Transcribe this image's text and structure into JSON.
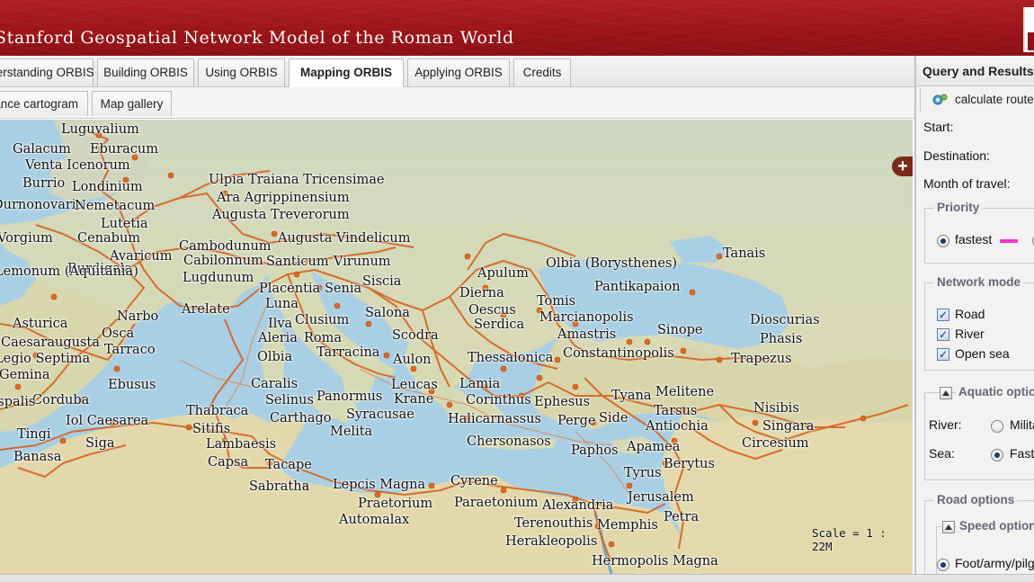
{
  "header": {
    "title": "Stanford Geospatial Network Model of the Roman World",
    "brand_color": "#9c1519"
  },
  "tabs": [
    {
      "label": "Understanding ORBIS"
    },
    {
      "label": "Building ORBIS"
    },
    {
      "label": "Using ORBIS"
    },
    {
      "label": "Mapping ORBIS",
      "active": true
    },
    {
      "label": "Applying ORBIS"
    },
    {
      "label": "Credits"
    }
  ],
  "subtabs": [
    {
      "label": "Distance cartogram"
    },
    {
      "label": "Map gallery"
    }
  ],
  "map": {
    "scale_text": "Scale = 1 : 22M",
    "zoom_in_label": "+",
    "road_color": "#d4621f",
    "sea_color": "#a9cfe4",
    "land_color": "#d8dcb7",
    "cities": [
      "Luguvalium",
      "Galacum",
      "Eburacum",
      "Venta Icenorum",
      "Burrio",
      "Londinium",
      "Durnonovaria",
      "Nemetacum",
      "Lutetia",
      "Vorgium",
      "Cenabum",
      "Avaricum",
      "Burdigala",
      "Lemonum (Aquitania)",
      "Narbo",
      "Lugdunum",
      "Arelate",
      "Cambodunum",
      "Cabilonnum",
      "Santicum",
      "Virunum",
      "Augusta Vindelicum",
      "Augusta Treverorum",
      "Ara Agrippinensium",
      "Ulpia Traiana Tricensimae",
      "Placentia",
      "Senia",
      "Siscia",
      "Luna",
      "Ilva",
      "Clusium",
      "Aleria",
      "Roma",
      "Olbia",
      "Tarracina",
      "Salona",
      "Scodra",
      "Aulon",
      "Caralis",
      "Selinus",
      "Panormus",
      "Carthago",
      "Syracusae",
      "Melita",
      "Leucas",
      "Krane",
      "Lamia",
      "Corinthus",
      "Ephesus",
      "Thessalonica",
      "Apulum",
      "Dierna",
      "Oescus",
      "Serdica",
      "Tomis",
      "Marcianopolis",
      "Olbia (Borysthenes)",
      "Pantikapaion",
      "Tanais",
      "Amastris",
      "Sinope",
      "Constantinopolis",
      "Dioscurias",
      "Phasis",
      "Trapezus",
      "Tyana",
      "Melitene",
      "Tarsus",
      "Antiochia",
      "Nisibis",
      "Singara",
      "Circesium",
      "Perge",
      "Side",
      "Halicarnassus",
      "Chersonasos",
      "Paphos",
      "Apamea",
      "Tyrus",
      "Berytus",
      "Jerusalem",
      "Petra",
      "Cyrene",
      "Paraetonium",
      "Alexandria",
      "Memphis",
      "Terenouthis",
      "Herakleopolis",
      "Hermopolis Magna",
      "Lepcis Magna",
      "Praetorium",
      "Automalax",
      "Sabratha",
      "Tacape",
      "Capsa",
      "Lambaesis",
      "Sitifis",
      "Thabraca",
      "Iol Caesarea",
      "Tingi",
      "Siga",
      "Banasa",
      "Corduba",
      "Ebusus",
      "Tarraco",
      "Osca",
      "Caesaraugusta",
      "Asturica",
      "Legio Septima",
      "Gemina",
      "Hispalis"
    ]
  },
  "panel": {
    "title": "Query and Results",
    "calculate_label": "calculate route",
    "start_label": "Start:",
    "destination_label": "Destination:",
    "month_label": "Month of travel:",
    "priority": {
      "legend": "Priority",
      "selected": "fastest",
      "swatch_color": "#ff33cc"
    },
    "network_mode": {
      "legend": "Network mode",
      "options": [
        {
          "label": "Road",
          "checked": true
        },
        {
          "label": "River",
          "checked": true
        },
        {
          "label": "Open sea",
          "checked": true
        }
      ]
    },
    "aquatic": {
      "legend": "Aquatic options",
      "river_label": "River:",
      "river_value": "Military",
      "sea_label": "Sea:",
      "sea_value": "Fastest"
    },
    "road": {
      "legend": "Road options",
      "speed_legend": "Speed options",
      "speed_value": "Foot/army/pilgrim"
    }
  }
}
